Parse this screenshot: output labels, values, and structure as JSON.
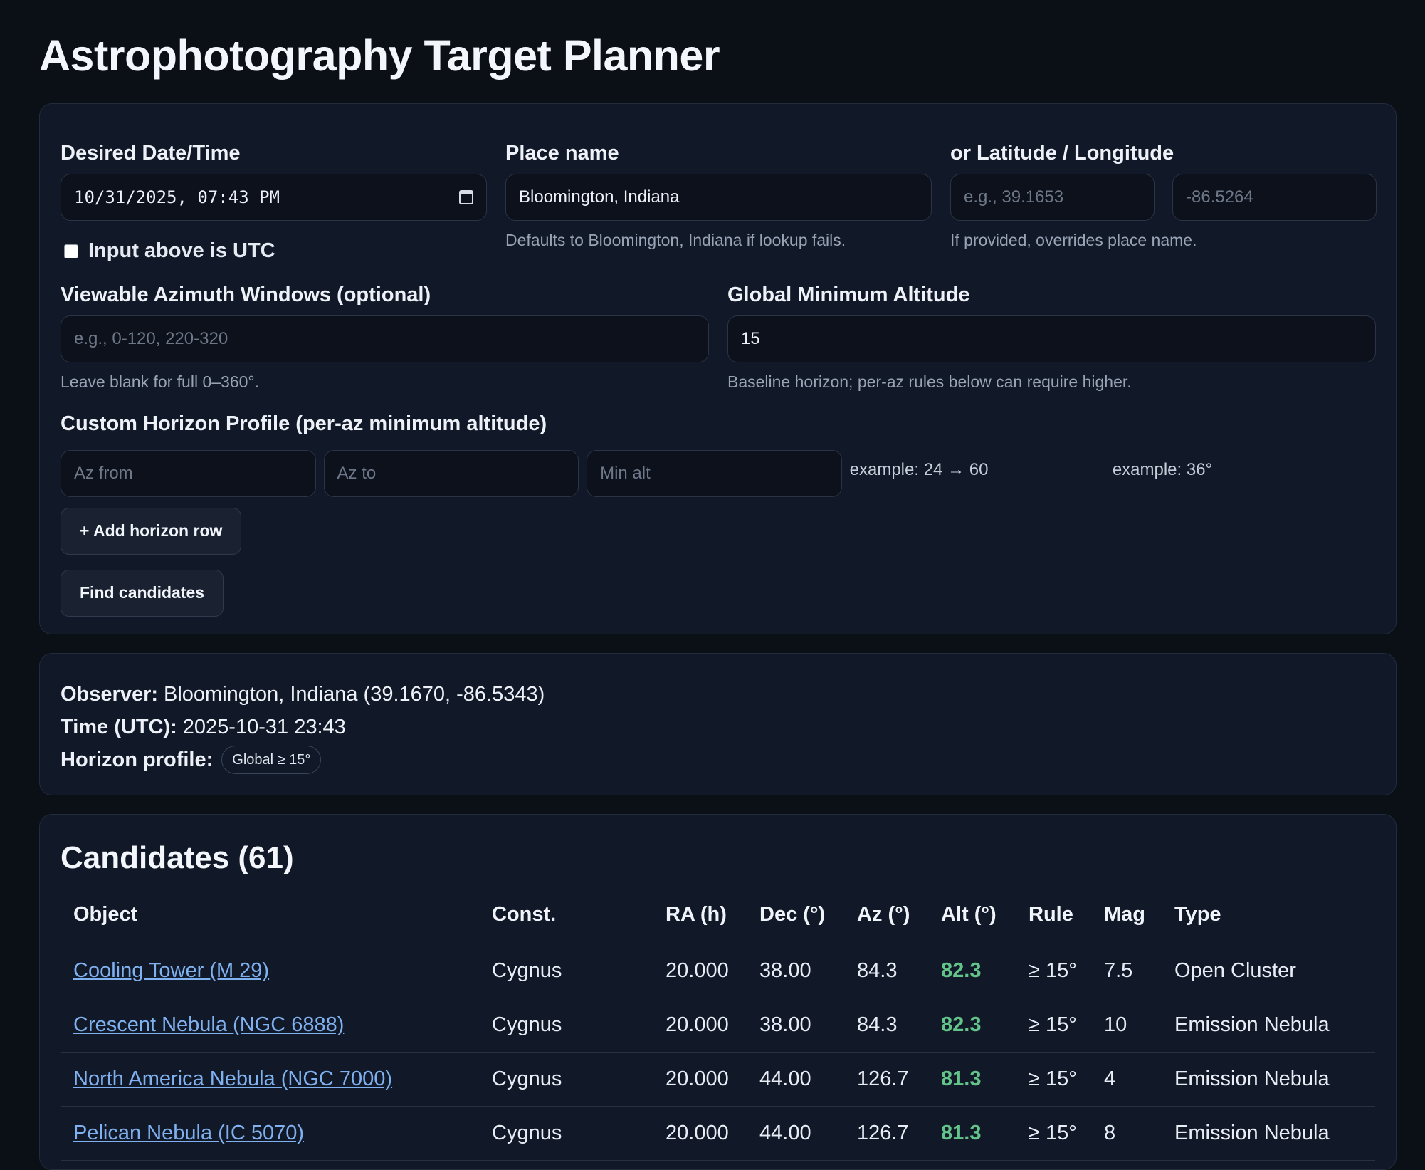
{
  "app": {
    "title": "Astrophotography Target Planner"
  },
  "form": {
    "datetime": {
      "label": "Desired Date/Time",
      "value": "10/31/2025, 07:43 PM"
    },
    "utc_checkbox": {
      "label": "Input above is UTC",
      "checked": false
    },
    "place": {
      "label": "Place name",
      "value": "Bloomington, Indiana",
      "hint": "Defaults to Bloomington, Indiana if lookup fails."
    },
    "latlon": {
      "label": "or Latitude / Longitude",
      "lat_placeholder": "e.g., 39.1653",
      "lon_placeholder": "-86.5264",
      "hint": "If provided, overrides place name."
    },
    "azimuth": {
      "label": "Viewable Azimuth Windows (optional)",
      "placeholder": "e.g., 0-120, 220-320",
      "hint": "Leave blank for full 0–360°."
    },
    "min_alt": {
      "label": "Global Minimum Altitude",
      "value": "15",
      "hint": "Baseline horizon; per-az rules below can require higher."
    },
    "horizon": {
      "label": "Custom Horizon Profile (per-az minimum altitude)",
      "az_from_placeholder": "Az from",
      "az_to_placeholder": "Az to",
      "min_alt_placeholder": "Min alt",
      "example_range": "example: 24 → 60",
      "example_alt": "example: 36°"
    },
    "add_row_button": "+ Add horizon row",
    "find_button": "Find candidates"
  },
  "summary": {
    "observer_label": "Observer:",
    "observer_value": "Bloomington, Indiana (39.1670, -86.5343)",
    "time_label": "Time (UTC):",
    "time_value": "2025-10-31 23:43",
    "horizon_label": "Horizon profile:",
    "horizon_pill": "Global ≥ 15°"
  },
  "results": {
    "title": "Candidates (61)",
    "columns": [
      "Object",
      "Const.",
      "RA (h)",
      "Dec (°)",
      "Az (°)",
      "Alt (°)",
      "Rule",
      "Mag",
      "Type"
    ],
    "rows": [
      [
        "Cooling Tower (M 29)",
        "Cygnus",
        "20.000",
        "38.00",
        "84.3",
        "82.3",
        "≥ 15°",
        "7.5",
        "Open Cluster"
      ],
      [
        "Crescent Nebula (NGC 6888)",
        "Cygnus",
        "20.000",
        "38.00",
        "84.3",
        "82.3",
        "≥ 15°",
        "10",
        "Emission Nebula"
      ],
      [
        "North America Nebula (NGC 7000)",
        "Cygnus",
        "20.000",
        "44.00",
        "126.7",
        "81.3",
        "≥ 15°",
        "4",
        "Emission Nebula"
      ],
      [
        "Pelican Nebula (IC 5070)",
        "Cygnus",
        "20.000",
        "44.00",
        "126.7",
        "81.3",
        "≥ 15°",
        "8",
        "Emission Nebula"
      ]
    ],
    "alt_color": "#63c48a",
    "link_color": "#7fb0ef"
  }
}
